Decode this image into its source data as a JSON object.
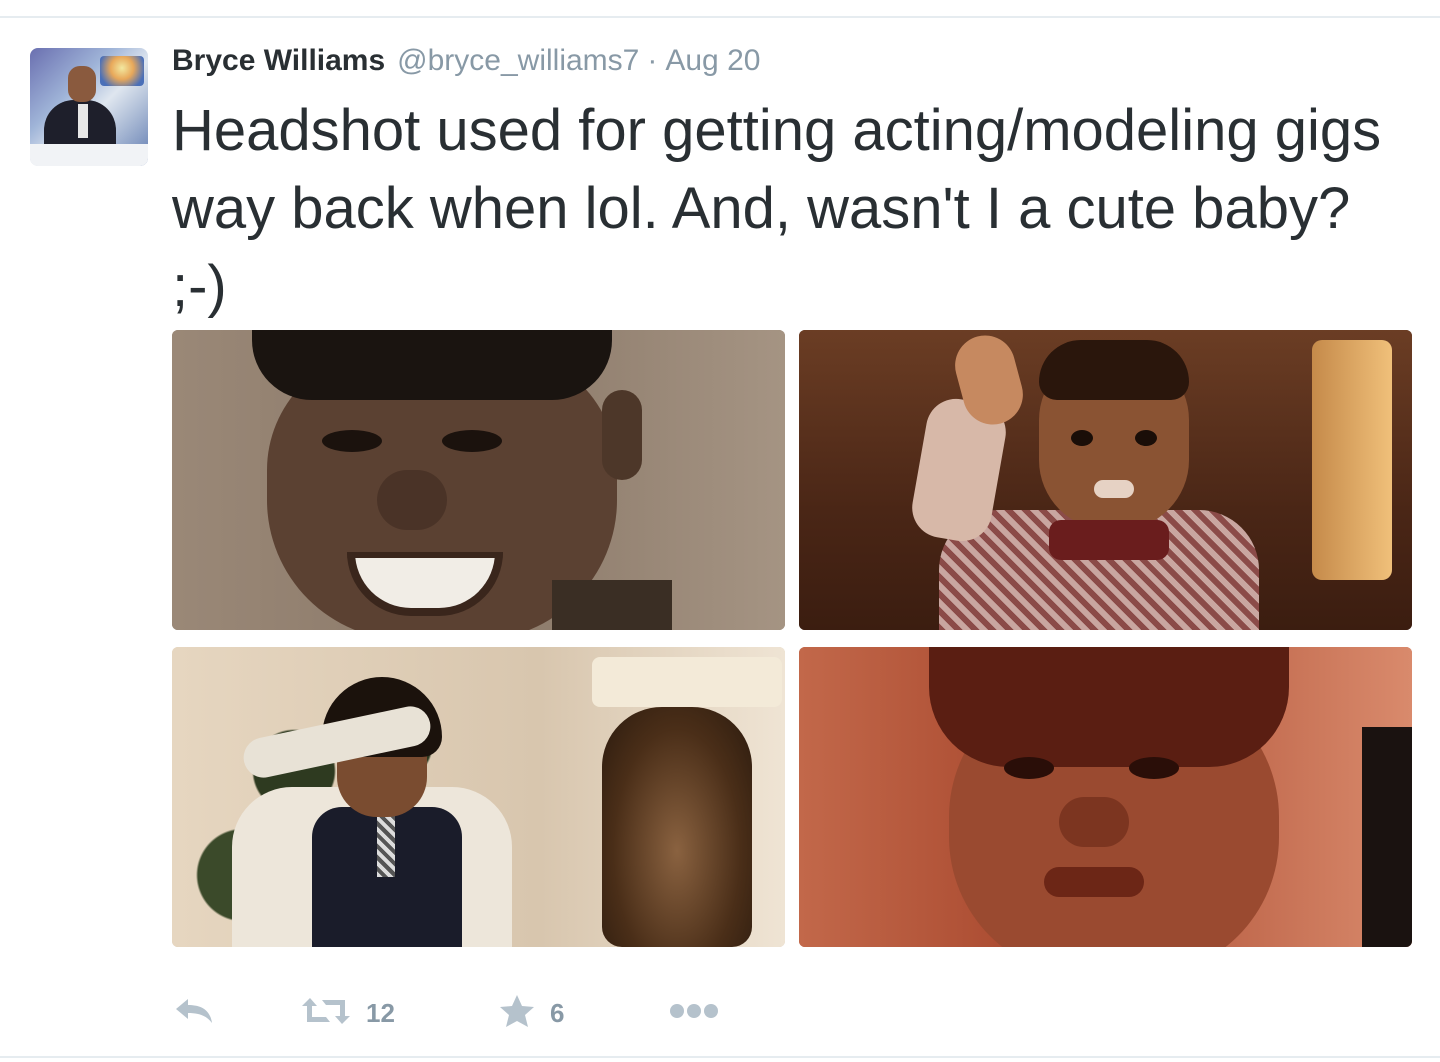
{
  "tweet": {
    "author_name": "Bryce Williams",
    "handle": "@bryce_williams7",
    "separator": "·",
    "date": "Aug 20",
    "text": "Headshot used for getting acting/modeling gigs way back when lol. And, wasn't I a cute baby? ;-)",
    "actions": {
      "reply_icon": "reply-icon",
      "retweet_icon": "retweet-icon",
      "retweet_count": "12",
      "favorite_icon": "star-icon",
      "favorite_count": "6",
      "more_icon": "more-dots-icon"
    },
    "colors": {
      "text": "#292f33",
      "secondary": "#8899a6",
      "icon": "#b5c2cc",
      "divider": "#e6ecf0"
    }
  }
}
